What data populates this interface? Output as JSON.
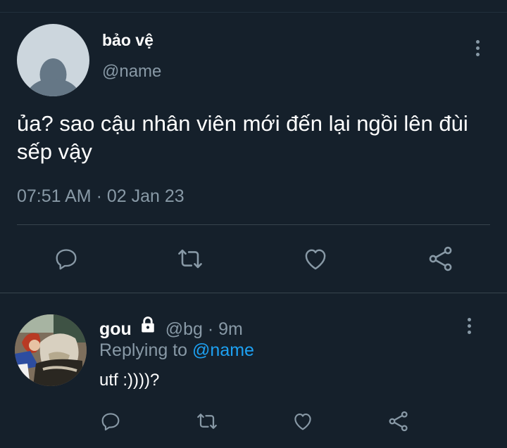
{
  "tweet": {
    "author_name": "bảo vệ",
    "author_handle": "@name",
    "text": "ủa? sao cậu nhân viên mới đến lại ngồi lên đùi sếp vậy",
    "timestamp": "07:51 AM · 02 Jan 23",
    "actions": [
      "reply-icon",
      "retweet-icon",
      "like-icon",
      "share-icon"
    ]
  },
  "reply": {
    "author_name": "gou",
    "author_handle": "@bg",
    "separator": "·",
    "time": "9m",
    "replying_prefix": "Replying to",
    "replying_to": "@name",
    "text": "utf :))))?",
    "actions": [
      "reply-icon",
      "retweet-icon",
      "like-icon",
      "share-icon"
    ]
  },
  "colors": {
    "background": "#15202b",
    "secondary_text": "#8899a6",
    "divider": "#38444d",
    "link": "#1da1f2",
    "default_avatar": "#ccd6dd",
    "default_avatar_figure": "#657786"
  }
}
